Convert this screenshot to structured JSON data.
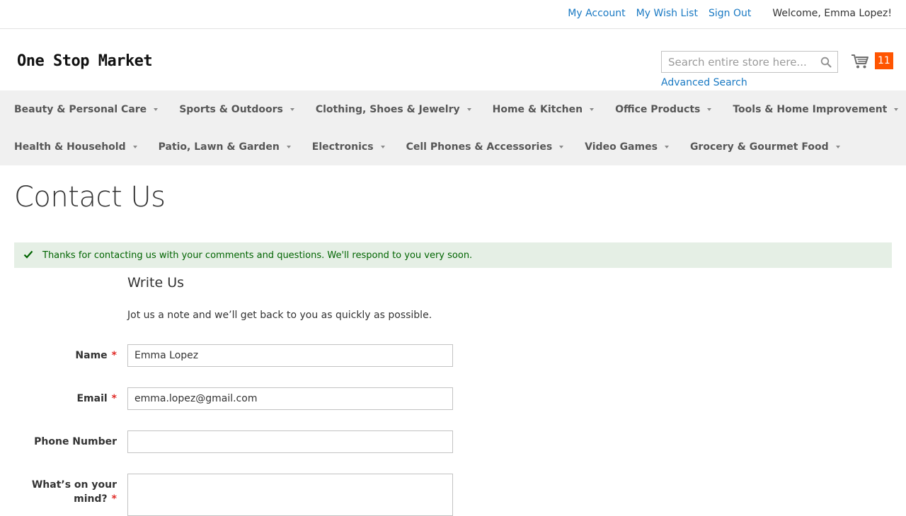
{
  "header": {
    "links": {
      "my_account": "My Account",
      "wish_list": "My Wish List",
      "sign_out": "Sign Out"
    },
    "welcome": "Welcome, Emma Lopez!",
    "logo_text": "One Stop Market",
    "search": {
      "placeholder": "Search entire store here...",
      "value": ""
    },
    "advanced_search": "Advanced Search",
    "cart": {
      "count": "11"
    }
  },
  "nav": {
    "row1": [
      "Beauty & Personal Care",
      "Sports & Outdoors",
      "Clothing, Shoes & Jewelry",
      "Home & Kitchen",
      "Office Products",
      "Tools & Home Improvement"
    ],
    "row2": [
      "Health & Household",
      "Patio, Lawn & Garden",
      "Electronics",
      "Cell Phones & Accessories",
      "Video Games",
      "Grocery & Gourmet Food"
    ]
  },
  "main": {
    "title": "Contact Us",
    "success_message": "Thanks for contacting us with your comments and questions. We'll respond to you very soon.",
    "form": {
      "legend": "Write Us",
      "note": "Jot us a note and we’ll get back to you as quickly as possible.",
      "required_mark": "*",
      "name": {
        "label": "Name",
        "value": "Emma Lopez"
      },
      "email": {
        "label": "Email",
        "value": "emma.lopez@gmail.com"
      },
      "phone": {
        "label": "Phone Number",
        "value": ""
      },
      "comment": {
        "label_line1": "What’s on your",
        "label_line2": "mind?",
        "value": ""
      }
    }
  },
  "colors": {
    "link": "#1979c3",
    "cart_badge": "#ff5501",
    "success_bg": "#e5efe5",
    "success_text": "#006400",
    "required": "#e02b27",
    "nav_bg": "#f0f0f0"
  },
  "icons": {
    "search": "search-icon",
    "cart": "cart-icon",
    "success": "checkmark-icon",
    "nav_caret": "chevron-down-icon"
  }
}
